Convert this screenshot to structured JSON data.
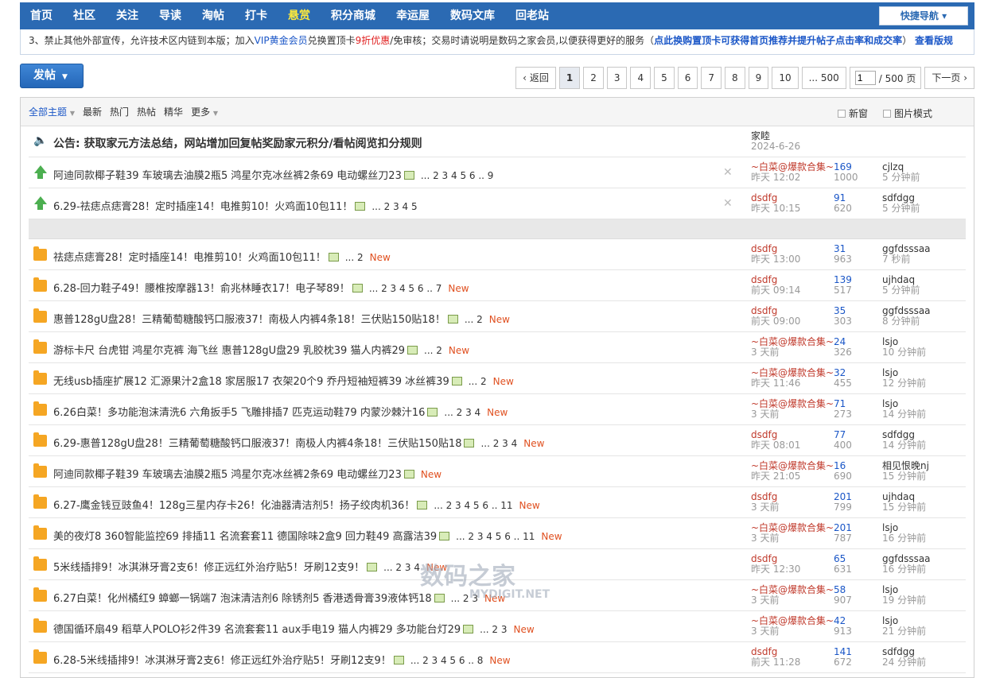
{
  "nav": {
    "items": [
      "首页",
      "社区",
      "关注",
      "导读",
      "淘帖",
      "打卡",
      "悬赏",
      "积分商城",
      "幸运屋",
      "数码文库",
      "回老站"
    ],
    "active_index": 6,
    "quick_nav": "快捷导航"
  },
  "notice": {
    "line3_prefix": "3、禁止其他外部宣传，允许技术区内链到本版；加入",
    "vip": "VIP黄金会员",
    "line3_mid": "兑换置顶卡",
    "discount": "9折优惠",
    "line3_mid2": "/免审核；交易时请说明是数码之家会员,以便获得更好的服务（",
    "link1": "点此换购置顶卡可获得首页推荐并提升帖子点击率和成交率",
    "line3_end": "）",
    "link2": "查看版规"
  },
  "post_button": {
    "label": "发帖"
  },
  "pager": {
    "prev": "返回",
    "pages": [
      "1",
      "2",
      "3",
      "4",
      "5",
      "6",
      "7",
      "8",
      "9",
      "10",
      "... 500"
    ],
    "current": "1",
    "input_value": "1",
    "total": "/ 500 页",
    "next": "下一页"
  },
  "filter": {
    "all": "全部主题",
    "items": [
      "最新",
      "热门",
      "热帖",
      "精华",
      "更多"
    ],
    "new_window": "新窗",
    "image_mode": "图片模式"
  },
  "announcement": {
    "title": "公告: 获取家元方法总结，网站增加回复帖奖励家元积分/看帖阅览扣分规则",
    "author": "家睦",
    "date": "2024-6-26"
  },
  "sticky": [
    {
      "title": "阿迪同款椰子鞋39 车玻璃去油膜2瓶5 鸿星尔克冰丝裤2条69 电动螺丝刀23",
      "pages": "... 2 3 4 5 6 .. 9",
      "author": "~白菜@爆款合集~",
      "date": "昨天 12:02",
      "replies": "169",
      "views": "1000",
      "last_user": "cjlzq",
      "last_time": "5 分钟前"
    },
    {
      "title": "6.29-祛痣点痣膏28！定时插座14！电推剪10！火鸡面10包11！",
      "pages": "... 2 3 4 5",
      "author": "dsdfg",
      "date": "昨天 10:15",
      "replies": "91",
      "views": "620",
      "last_user": "sdfdgg",
      "last_time": "5 分钟前"
    }
  ],
  "threads": [
    {
      "title": "祛痣点痣膏28！定时插座14！电推剪10！火鸡面10包11！",
      "pages": "... 2",
      "new": "New",
      "author": "dsdfg",
      "date": "昨天 13:00",
      "replies": "31",
      "views": "963",
      "last_user": "ggfdsssaa",
      "last_time": "7 秒前"
    },
    {
      "title": "6.28-回力鞋子49！腰椎按摩器13！俞兆林睡衣17！电子琴89！",
      "pages": "... 2 3 4 5 6 .. 7",
      "new": "New",
      "author": "dsdfg",
      "date": "前天 09:14",
      "replies": "139",
      "views": "517",
      "last_user": "ujhdaq",
      "last_time": "5 分钟前"
    },
    {
      "title": "惠普128gU盘28！三精葡萄糖酸钙口服液37！南极人内裤4条18！三伏贴150贴18！",
      "pages": "... 2",
      "new": "New",
      "author": "dsdfg",
      "date": "前天 09:00",
      "replies": "35",
      "views": "303",
      "last_user": "ggfdsssaa",
      "last_time": "8 分钟前"
    },
    {
      "title": "游标卡尺 台虎钳 鸿星尔克裤 海飞丝 惠普128gU盘29 乳胶枕39 猫人内裤29",
      "pages": "... 2",
      "new": "New",
      "author": "~白菜@爆款合集~",
      "date": "3 天前",
      "replies": "24",
      "views": "326",
      "last_user": "lsjo",
      "last_time": "10 分钟前"
    },
    {
      "title": "无线usb插座扩展12 汇源果汁2盒18 家居服17 衣架20个9 乔丹短袖短裤39 冰丝裤39",
      "pages": "... 2",
      "new": "New",
      "author": "~白菜@爆款合集~",
      "date": "昨天 11:46",
      "replies": "32",
      "views": "455",
      "last_user": "lsjo",
      "last_time": "12 分钟前"
    },
    {
      "title": "6.26白菜！多功能泡沫清洗6 六角扳手5 飞雕排插7 匹克运动鞋79 内蒙沙棘汁16",
      "pages": "... 2 3 4",
      "new": "New",
      "author": "~白菜@爆款合集~",
      "date": "3 天前",
      "replies": "71",
      "views": "273",
      "last_user": "lsjo",
      "last_time": "14 分钟前"
    },
    {
      "title": "6.29-惠普128gU盘28！三精葡萄糖酸钙口服液37！南极人内裤4条18！三伏贴150贴18",
      "pages": "... 2 3 4",
      "new": "New",
      "author": "dsdfg",
      "date": "昨天 08:01",
      "replies": "77",
      "views": "400",
      "last_user": "sdfdgg",
      "last_time": "14 分钟前"
    },
    {
      "title": "阿迪同款椰子鞋39 车玻璃去油膜2瓶5 鸿星尔克冰丝裤2条69 电动螺丝刀23",
      "pages": "",
      "new": "New",
      "author": "~白菜@爆款合集~",
      "date": "昨天 21:05",
      "replies": "16",
      "views": "690",
      "last_user": "相见恨晚nj",
      "last_time": "15 分钟前"
    },
    {
      "title": "6.27-鹰金钱豆豉鱼4！128g三星内存卡26！化油器清洁剂5！扬子绞肉机36！",
      "pages": "... 2 3 4 5 6 .. 11",
      "new": "New",
      "author": "dsdfg",
      "date": "3 天前",
      "replies": "201",
      "views": "799",
      "last_user": "ujhdaq",
      "last_time": "15 分钟前"
    },
    {
      "title": "美的夜灯8 360智能监控69 排插11 名流套套11 德国除味2盒9 回力鞋49 高露洁39",
      "pages": "... 2 3 4 5 6 .. 11",
      "new": "New",
      "author": "~白菜@爆款合集~",
      "date": "3 天前",
      "replies": "201",
      "views": "787",
      "last_user": "lsjo",
      "last_time": "16 分钟前"
    },
    {
      "title": "5米线插排9！冰淇淋牙膏2支6！修正远红外治疗贴5！牙刷12支9！",
      "pages": "... 2 3 4",
      "new": "New",
      "author": "dsdfg",
      "date": "昨天 12:30",
      "replies": "65",
      "views": "631",
      "last_user": "ggfdsssaa",
      "last_time": "16 分钟前"
    },
    {
      "title": "6.27白菜！化州橘红9 蟑螂一锅端7 泡沫清洁剂6 除锈剂5 香港透骨膏39液体钙18",
      "pages": "... 2 3",
      "new": "New",
      "author": "~白菜@爆款合集~",
      "date": "3 天前",
      "replies": "58",
      "views": "907",
      "last_user": "lsjo",
      "last_time": "19 分钟前"
    },
    {
      "title": "德国循环扇49 稻草人POLO衫2件39 名流套套11 aux手电19 猫人内裤29 多功能台灯29",
      "pages": "... 2 3",
      "new": "New",
      "author": "~白菜@爆款合集~",
      "date": "3 天前",
      "replies": "42",
      "views": "913",
      "last_user": "lsjo",
      "last_time": "21 分钟前"
    },
    {
      "title": "6.28-5米线插排9！冰淇淋牙膏2支6！修正远红外治疗贴5！牙刷12支9！",
      "pages": "... 2 3 4 5 6 .. 8",
      "new": "New",
      "author": "dsdfg",
      "date": "前天 11:28",
      "replies": "141",
      "views": "672",
      "last_user": "sdfdgg",
      "last_time": "24 分钟前"
    }
  ],
  "watermark": {
    "main": "数码之家",
    "sub": "MYDIGIT.NET"
  }
}
